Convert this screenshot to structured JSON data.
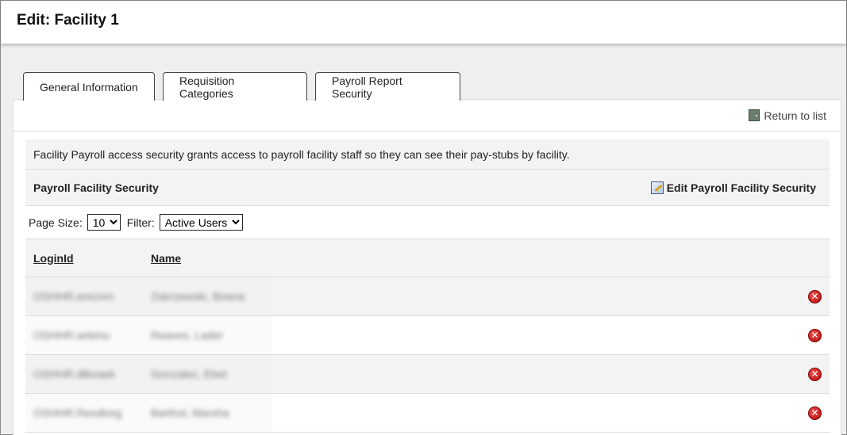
{
  "header": {
    "title": "Edit: Facility 1"
  },
  "tabs": [
    {
      "label": "General Information"
    },
    {
      "label": "Requisition Categories"
    },
    {
      "label": "Payroll Report Security"
    }
  ],
  "toolbar": {
    "return_label": "Return to list"
  },
  "info": {
    "text": "Facility Payroll access security grants access to payroll facility staff so they can see their pay-stubs by facility."
  },
  "section": {
    "title": "Payroll Facility Security",
    "edit_label": "Edit Payroll Facility Security"
  },
  "controls": {
    "page_size_label": "Page Size:",
    "page_size_value": "10",
    "filter_label": "Filter:",
    "filter_value": "Active Users"
  },
  "table": {
    "columns": [
      "LoginId",
      "Name"
    ],
    "rows": [
      {
        "login": "OSHHR.emcnrn",
        "name": "Zakrzewski, Briana"
      },
      {
        "login": "OSHHR.wrbmu",
        "name": "Reaves, Lader"
      },
      {
        "login": "OSHHR.dlbvaek",
        "name": "Gonzalez, Ebet"
      },
      {
        "login": "OSHHR.Rexdtreg",
        "name": "Barthol, Marsha"
      }
    ]
  },
  "icons": {
    "return": "door-icon",
    "edit": "edit-icon",
    "delete": "delete-icon"
  },
  "colors": {
    "delete": "#c41616",
    "panel_shade": "#f3f3f3"
  }
}
